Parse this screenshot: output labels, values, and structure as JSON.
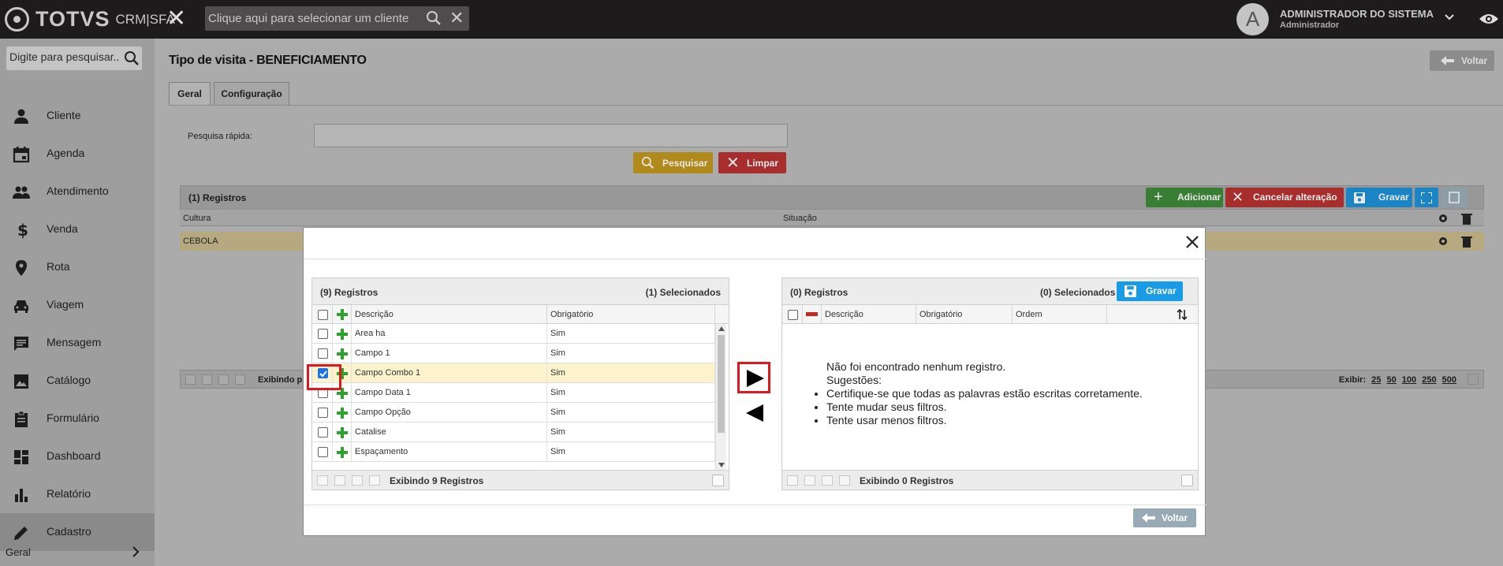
{
  "app": {
    "brand": "TOTVS",
    "product": "CRM|SFA"
  },
  "header": {
    "client_placeholder": "Clique aqui para selecionar um cliente",
    "avatar_letter": "A",
    "user_name": "ADMINISTRADOR DO SISTEMA",
    "user_role": "Administrador"
  },
  "sidebar": {
    "search_placeholder": "Digite para pesquisar...",
    "items": [
      {
        "label": "Cliente",
        "icon": "person-icon"
      },
      {
        "label": "Agenda",
        "icon": "calendar-icon"
      },
      {
        "label": "Atendimento",
        "icon": "people-icon"
      },
      {
        "label": "Venda",
        "icon": "dollar-icon"
      },
      {
        "label": "Rota",
        "icon": "location-pin-icon"
      },
      {
        "label": "Viagem",
        "icon": "car-icon"
      },
      {
        "label": "Mensagem",
        "icon": "message-icon"
      },
      {
        "label": "Catálogo",
        "icon": "image-icon"
      },
      {
        "label": "Formulário",
        "icon": "clipboard-icon"
      },
      {
        "label": "Dashboard",
        "icon": "dashboard-icon"
      },
      {
        "label": "Relatório",
        "icon": "bar-chart-icon"
      },
      {
        "label": "Cadastro",
        "icon": "pencil-icon",
        "active": true
      }
    ],
    "footer_label": "Geral"
  },
  "page": {
    "title": "Tipo de visita - BENEFICIAMENTO",
    "back_label": "Voltar",
    "tabs": [
      "Geral",
      "Configuração"
    ],
    "search_label": "Pesquisa rápida:",
    "search_button": "Pesquisar",
    "clear_button": "Limpar",
    "grid": {
      "count_label": "(1) Registros",
      "add_button": "Adicionar",
      "cancel_button": "Cancelar alteração",
      "save_button": "Gravar",
      "columns": [
        "Cultura",
        "Situação"
      ],
      "rows": [
        {
          "cultura": "CEBOLA",
          "situacao": ""
        }
      ],
      "pager_text": "Exibindo p",
      "show_label": "Exibir:",
      "page_sizes": [
        "25",
        "50",
        "100",
        "250",
        "500"
      ]
    }
  },
  "modal": {
    "left": {
      "count_label": "(9) Registros",
      "selected_label": "(1) Selecionados",
      "columns": [
        "Descrição",
        "Obrigatório"
      ],
      "rows": [
        {
          "desc": "Area ha",
          "obrig": "Sim",
          "checked": false
        },
        {
          "desc": "Campo 1",
          "obrig": "Sim",
          "checked": false
        },
        {
          "desc": "Campo Combo 1",
          "obrig": "Sim",
          "checked": true
        },
        {
          "desc": "Campo Data 1",
          "obrig": "Sim",
          "checked": false
        },
        {
          "desc": "Campo Opção",
          "obrig": "Sim",
          "checked": false
        },
        {
          "desc": "Catalise",
          "obrig": "Sim",
          "checked": false
        },
        {
          "desc": "Espaçamento",
          "obrig": "Sim",
          "checked": false
        }
      ],
      "footer": "Exibindo 9 Registros"
    },
    "right": {
      "count_label": "(0) Registros",
      "selected_label": "(0) Selecionados",
      "save_button": "Gravar",
      "columns": [
        "Descrição",
        "Obrigatório",
        "Ordem"
      ],
      "empty_title": "Não foi encontrado nenhum registro.",
      "empty_sub": "Sugestões:",
      "suggestions": [
        "Certifique-se que todas as palavras estão escritas corretamente.",
        "Tente mudar seus filtros.",
        "Tente usar menos filtros."
      ],
      "footer": "Exibindo 0 Registros"
    },
    "back_label": "Voltar"
  },
  "colors": {
    "topbar": "#1d1b1b",
    "add_green": "#3a7d34",
    "cancel_red": "#a82e2e",
    "save_blue": "#1a9be6",
    "search_yellow": "#b08a1a",
    "highlight_red": "#e0171f",
    "plus_green": "#2ea12e"
  }
}
